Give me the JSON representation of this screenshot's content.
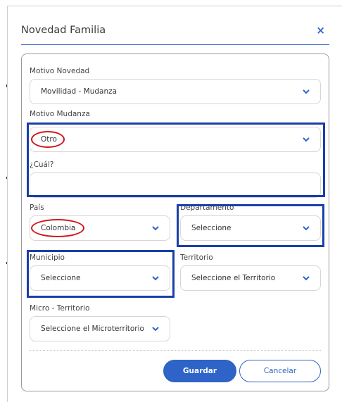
{
  "modal": {
    "title": "Novedad Familia",
    "close_symbol": "×"
  },
  "form": {
    "motivo_novedad": {
      "label": "Motivo Novedad",
      "value": "Movilidad - Mudanza"
    },
    "motivo_mudanza": {
      "label": "Motivo Mudanza",
      "value": "Otro"
    },
    "cual": {
      "label": "¿Cuál?",
      "value": ""
    },
    "pais": {
      "label": "País",
      "value": "Colombia"
    },
    "departamento": {
      "label": "Departamento",
      "value": "Seleccione"
    },
    "municipio": {
      "label": "Municipio",
      "value": "Seleccione"
    },
    "territorio": {
      "label": "Territorio",
      "value": "Seleccione el Territorio"
    },
    "micro_territorio": {
      "label": "Micro - Territorio",
      "value": "Seleccione el Microterritorio"
    }
  },
  "actions": {
    "save": "Guardar",
    "cancel": "Cancelar"
  },
  "colors": {
    "accent": "#2e63c8",
    "highlight_box": "#1a3fa8",
    "annotation_red": "#d0161b"
  },
  "icons": {
    "close": "close-icon",
    "dropdown": "chevron-down-icon"
  }
}
